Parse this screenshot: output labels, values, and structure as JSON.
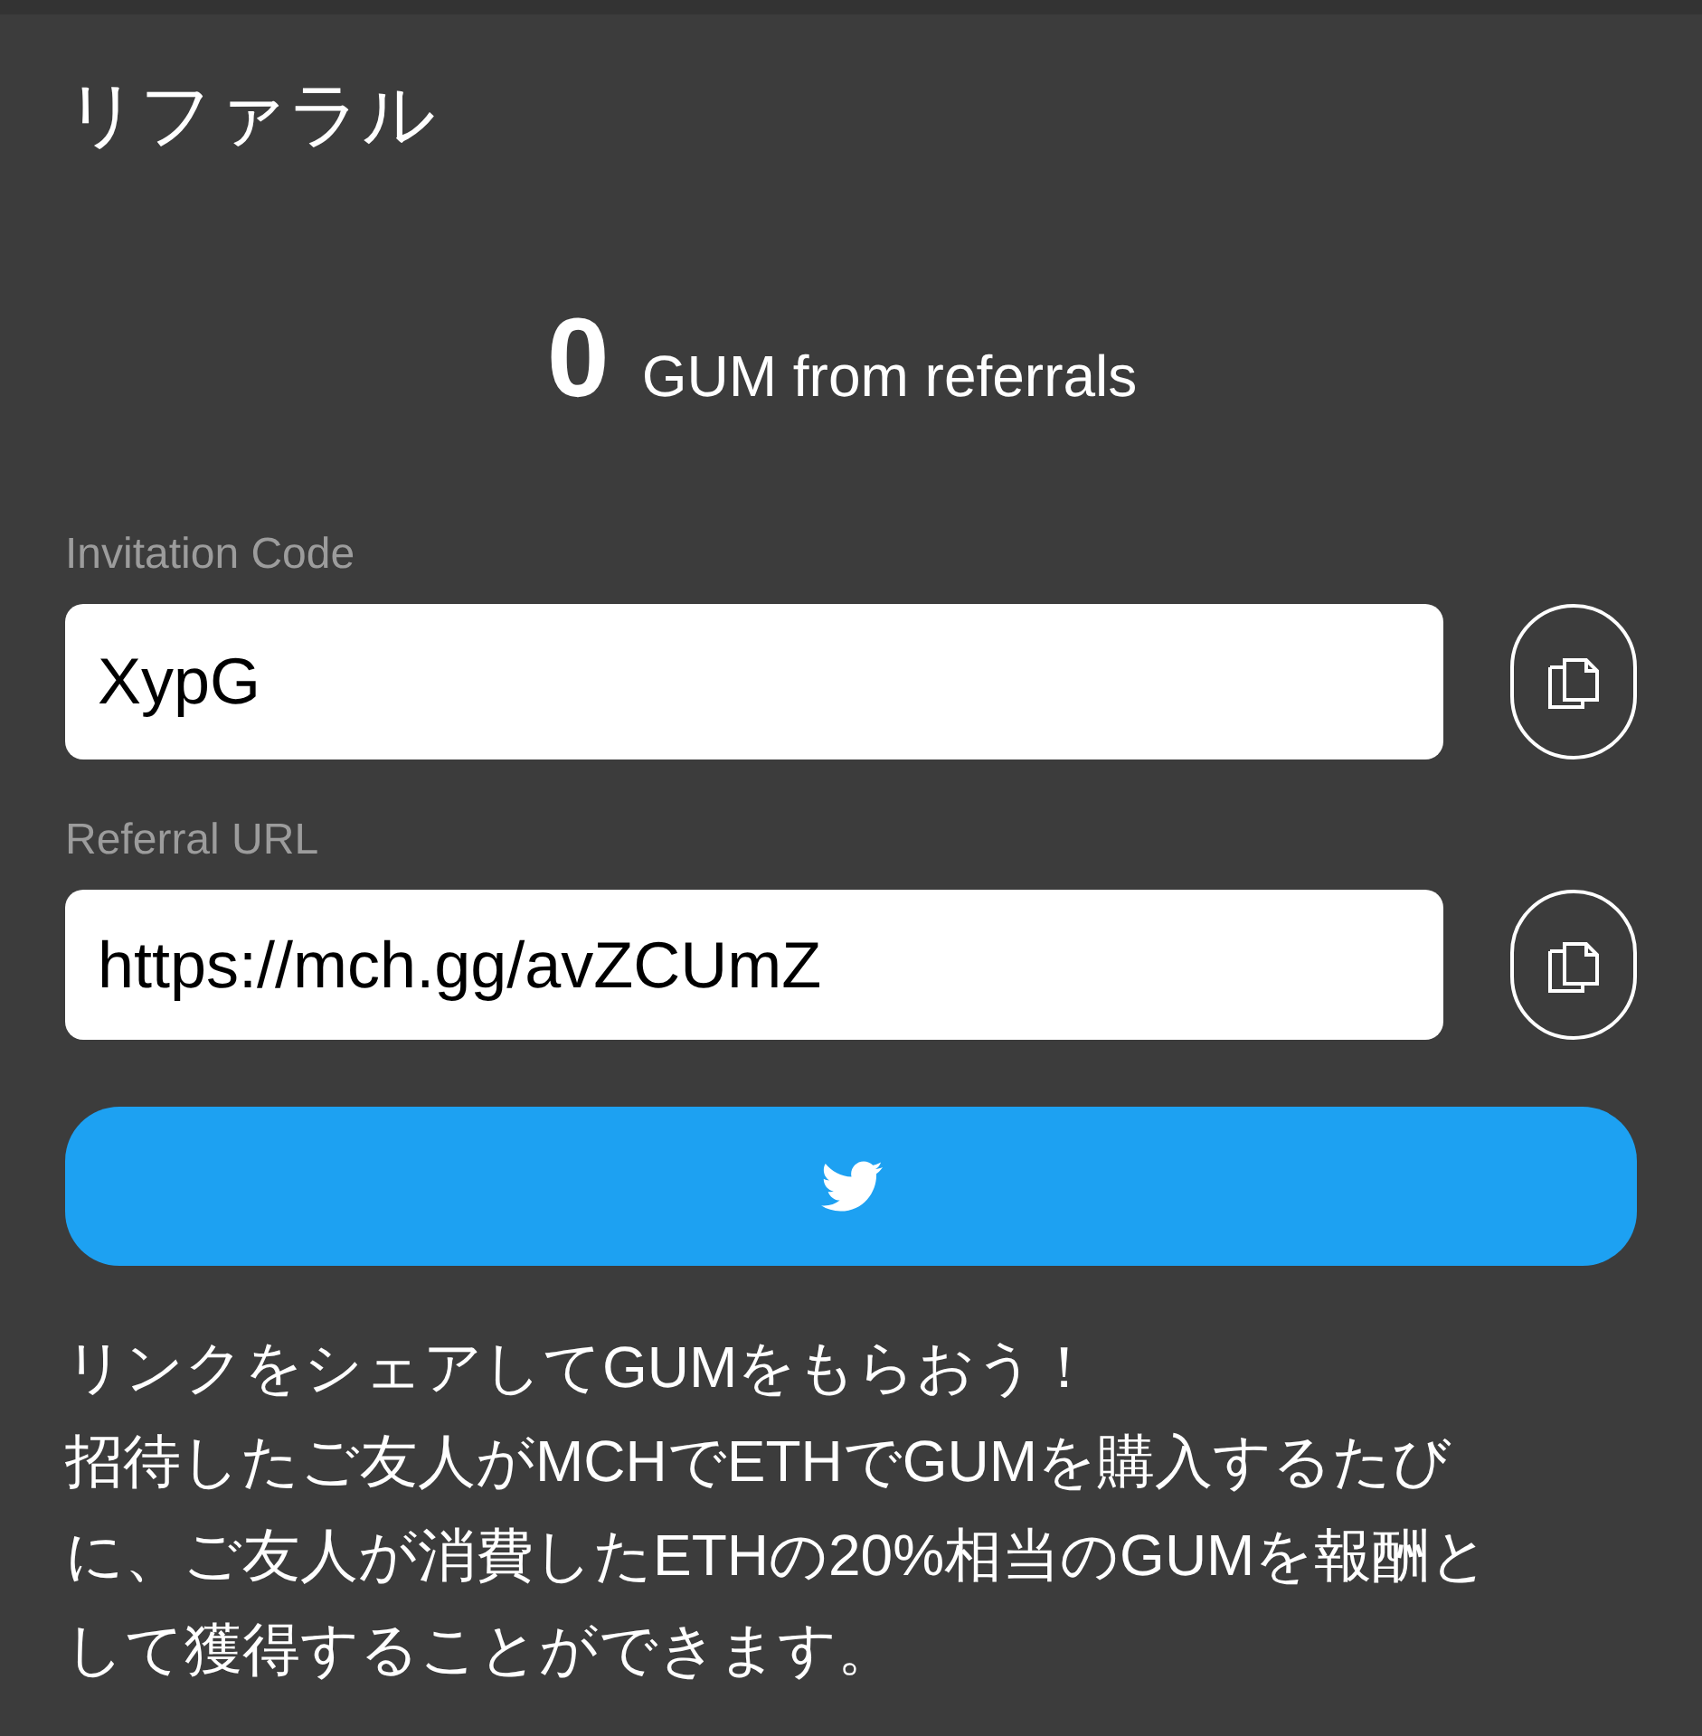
{
  "page": {
    "title": "リファラル"
  },
  "earnings": {
    "amount": "0",
    "label": "GUM from referrals"
  },
  "fields": [
    {
      "label": "Invitation Code",
      "value": "XypG"
    },
    {
      "label": "Referral URL",
      "value": "https://mch.gg/avZCUmZ"
    }
  ],
  "description": [
    "リンクをシェアしてGUMをもらおう！",
    "招待したご友人がMCHでETHでGUMを購入するたびに、ご友人が消費したETHの20%相当のGUMを報酬として獲得することができます。"
  ]
}
